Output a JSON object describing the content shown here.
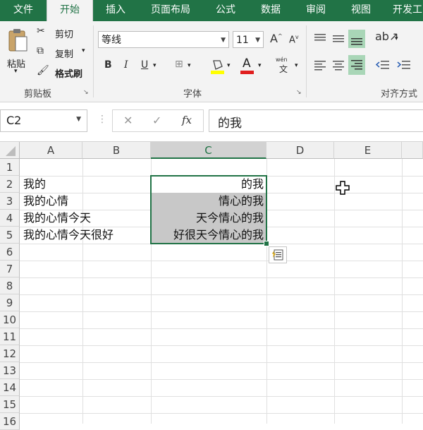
{
  "tabs": [
    "文件",
    "开始",
    "插入",
    "页面布局",
    "公式",
    "数据",
    "审阅",
    "视图",
    "开发工"
  ],
  "clipboard": {
    "paste": "粘贴",
    "cut": "剪切",
    "copy": "复制",
    "format_painter": "格式刷",
    "group_label": "剪贴板"
  },
  "font": {
    "name": "等线",
    "size": "11",
    "group_label": "字体",
    "bold": "B",
    "italic": "I",
    "underline": "U",
    "font_color_glyph": "A",
    "grow_glyph": "A",
    "shrink_glyph": "A",
    "phonetic_top": "wén",
    "phonetic_bottom": "文"
  },
  "alignment": {
    "group_label": "对齐方式"
  },
  "formula_bar": {
    "name_box": "C2",
    "fx": "fx",
    "formula": "的我",
    "cancel": "✕",
    "enter": "✓"
  },
  "columns": [
    "A",
    "B",
    "C",
    "D",
    "E"
  ],
  "rows": [
    "1",
    "2",
    "3",
    "4",
    "5",
    "6",
    "7",
    "8",
    "9",
    "10",
    "11",
    "12",
    "13",
    "14",
    "15",
    "16"
  ],
  "cells": {
    "A2": "我的",
    "A3": "我的心情",
    "A4": "我的心情今天",
    "A5": "我的心情今天很好",
    "C2": "的我",
    "C3": "情心的我",
    "C4": "天今情心的我",
    "C5": "好很天今情心的我"
  },
  "colors": {
    "brand": "#217346",
    "selection_fill": "#c8c8c8",
    "font_color_bar": "#e01e1e",
    "highlight_bar": "#ffff00"
  }
}
